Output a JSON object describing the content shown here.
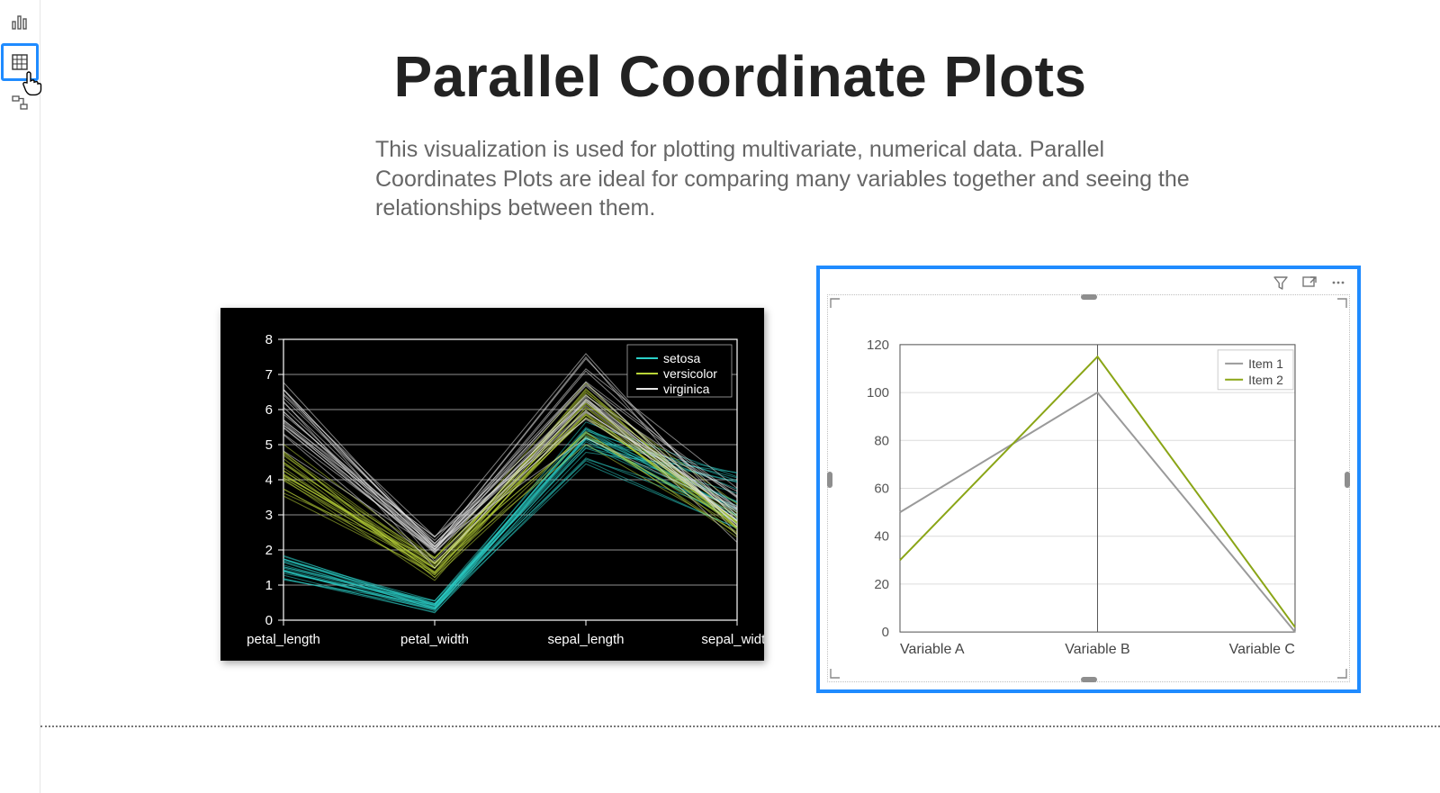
{
  "page": {
    "title": "Parallel Coordinate Plots",
    "subtitle": "This visualization is used for plotting multivariate, numerical data. Parallel Coordinates Plots are ideal for comparing many variables together and seeing the relationships between them."
  },
  "rail": {
    "items": [
      {
        "name": "report-view",
        "label": "Report view",
        "selected": false
      },
      {
        "name": "data-view",
        "label": "Data view",
        "selected": true
      },
      {
        "name": "model-view",
        "label": "Model view",
        "selected": false
      }
    ]
  },
  "visual_toolbar": {
    "filter_label": "Filters",
    "focus_mode_label": "Focus mode",
    "more_label": "More options"
  },
  "chart_data": [
    {
      "id": "iris-parallel",
      "type": "parallel",
      "title": "",
      "background": "#000000",
      "foreground": "#ffffff",
      "axes": [
        "petal_length",
        "petal_width",
        "sepal_length",
        "sepal_width"
      ],
      "yticks": [
        0,
        1,
        2,
        3,
        4,
        5,
        6,
        7,
        8
      ],
      "ylim": [
        0,
        8
      ],
      "legend": {
        "position": "top-right",
        "entries": [
          {
            "name": "setosa",
            "color": "#2bd0c8"
          },
          {
            "name": "versicolor",
            "color": "#b9d438"
          },
          {
            "name": "virginica",
            "color": "#e6e6e6"
          }
        ]
      },
      "class_centroids": [
        {
          "name": "setosa",
          "values": [
            1.46,
            0.25,
            5.01,
            3.43
          ]
        },
        {
          "name": "versicolor",
          "values": [
            4.26,
            1.33,
            5.94,
            2.77
          ]
        },
        {
          "name": "virginica",
          "values": [
            5.55,
            2.03,
            6.59,
            2.97
          ]
        }
      ],
      "class_ranges": [
        {
          "name": "setosa",
          "min": [
            1.0,
            0.1,
            4.3,
            2.3
          ],
          "max": [
            1.9,
            0.6,
            5.8,
            4.4
          ]
        },
        {
          "name": "versicolor",
          "min": [
            3.0,
            1.0,
            4.9,
            2.0
          ],
          "max": [
            5.1,
            1.8,
            7.0,
            3.4
          ]
        },
        {
          "name": "virginica",
          "min": [
            4.5,
            1.4,
            4.9,
            2.2
          ],
          "max": [
            6.9,
            2.5,
            7.9,
            3.8
          ]
        }
      ]
    },
    {
      "id": "item-parallel",
      "type": "parallel",
      "title": "",
      "background": "#ffffff",
      "axes": [
        "Variable A",
        "Variable B",
        "Variable C"
      ],
      "yticks": [
        0,
        20,
        40,
        60,
        80,
        100,
        120
      ],
      "ylim": [
        0,
        120
      ],
      "legend": {
        "position": "top-right",
        "entries": [
          {
            "name": "Item 1",
            "color": "#9a9a9a"
          },
          {
            "name": "Item 2",
            "color": "#8aa516"
          }
        ]
      },
      "series": [
        {
          "name": "Item 1",
          "color": "#9a9a9a",
          "values": [
            50,
            100,
            0
          ]
        },
        {
          "name": "Item 2",
          "color": "#8aa516",
          "values": [
            30,
            115,
            2
          ]
        }
      ]
    }
  ]
}
